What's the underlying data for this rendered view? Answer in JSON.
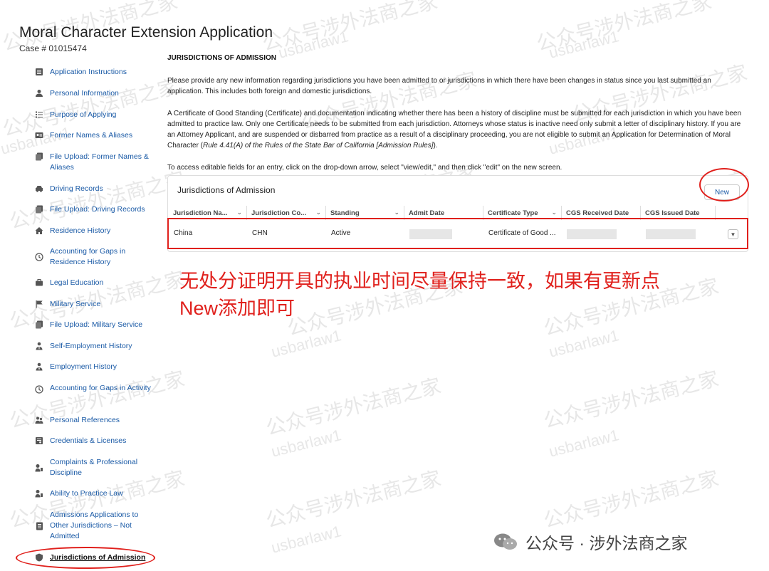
{
  "app": {
    "title": "Moral Character Extension Application",
    "case_number": "Case # 01015474"
  },
  "sidebar": {
    "items": [
      {
        "label": "Application Instructions",
        "icon": "list-icon"
      },
      {
        "label": "Personal Information",
        "icon": "person-icon"
      },
      {
        "label": "Purpose of Applying",
        "icon": "checklist-icon"
      },
      {
        "label": "Former Names & Aliases",
        "icon": "id-card-icon"
      },
      {
        "label": "File Upload: Former Names & Aliases",
        "icon": "file-upload-icon"
      },
      {
        "label": "Driving Records",
        "icon": "car-icon"
      },
      {
        "label": "File Upload: Driving Records",
        "icon": "file-upload-icon"
      },
      {
        "label": "Residence History",
        "icon": "home-icon"
      },
      {
        "label": "Accounting for Gaps in Residence History",
        "icon": "clock-icon"
      },
      {
        "label": "Legal Education",
        "icon": "briefcase-icon"
      },
      {
        "label": "Military Service",
        "icon": "flag-icon"
      },
      {
        "label": "File Upload: Military Service",
        "icon": "file-upload-icon"
      },
      {
        "label": "Self-Employment History",
        "icon": "user-tie-icon"
      },
      {
        "label": "Employment History",
        "icon": "user-tie-icon"
      },
      {
        "label": "Accounting for Gaps in Activity",
        "icon": "clock-icon"
      },
      {
        "label": "Personal References",
        "icon": "people-icon"
      },
      {
        "label": "Credentials & Licenses",
        "icon": "certificate-icon"
      },
      {
        "label": "Complaints & Professional Discipline",
        "icon": "gavel-icon"
      },
      {
        "label": "Ability to Practice Law",
        "icon": "gavel-icon"
      },
      {
        "label": "Admissions Applications to Other Jurisdictions – Not Admitted",
        "icon": "document-icon"
      },
      {
        "label": "Jurisdictions of Admission",
        "icon": "shield-icon",
        "active": true
      }
    ]
  },
  "main": {
    "heading": "JURISDICTIONS OF ADMISSION",
    "para1": "Please provide any new information regarding jurisdictions you have been admitted to or jurisdictions in which there have been changes in status since you last submitted an application. This includes both foreign and domestic jurisdictions.",
    "para2a": "A Certificate of Good Standing (Certificate) and documentation indicating whether there has been a history of discipline must be submitted for each jurisdiction in which you have been admitted to practice law. Only one Certificate needs to be submitted from each jurisdiction. Attorneys whose status is inactive need only submit a letter of disciplinary history. If you are an Attorney Applicant, and are suspended or disbarred from practice as a result of a disciplinary proceeding, you are not eligible to submit an Application for Determination of Moral Character (",
    "para2_italic": "Rule 4.41(A) of the Rules of the State Bar of California [Admission Rules]",
    "para2b": ").",
    "para3": "To access editable fields for an entry, click on the drop-down arrow, select \"view/edit,\" and then click \"edit\" on the new screen."
  },
  "table": {
    "title": "Jurisdictions of Admission",
    "new_label": "New",
    "columns": [
      "Jurisdiction Na...",
      "Jurisdiction Co...",
      "Standing",
      "Admit Date",
      "Certificate Type",
      "CGS Received Date",
      "CGS Issued Date"
    ],
    "rows": [
      {
        "name": "China",
        "code": "CHN",
        "standing": "Active",
        "admit_date": "",
        "certificate_type": "Certificate of Good ...",
        "cgs_received": "",
        "cgs_issued": ""
      }
    ]
  },
  "annotation": {
    "line1": "无处分证明开具的执业时间尽量保持一致，如果有更新点",
    "line2": "New添加即可"
  },
  "footer": {
    "text": "公众号 · 涉外法商之家"
  },
  "watermarks": {
    "cn": "公众号涉外法商之家",
    "en": "usbarlaw1"
  },
  "colors": {
    "link": "#1a5aa6",
    "annotation_red": "#e0201c"
  }
}
